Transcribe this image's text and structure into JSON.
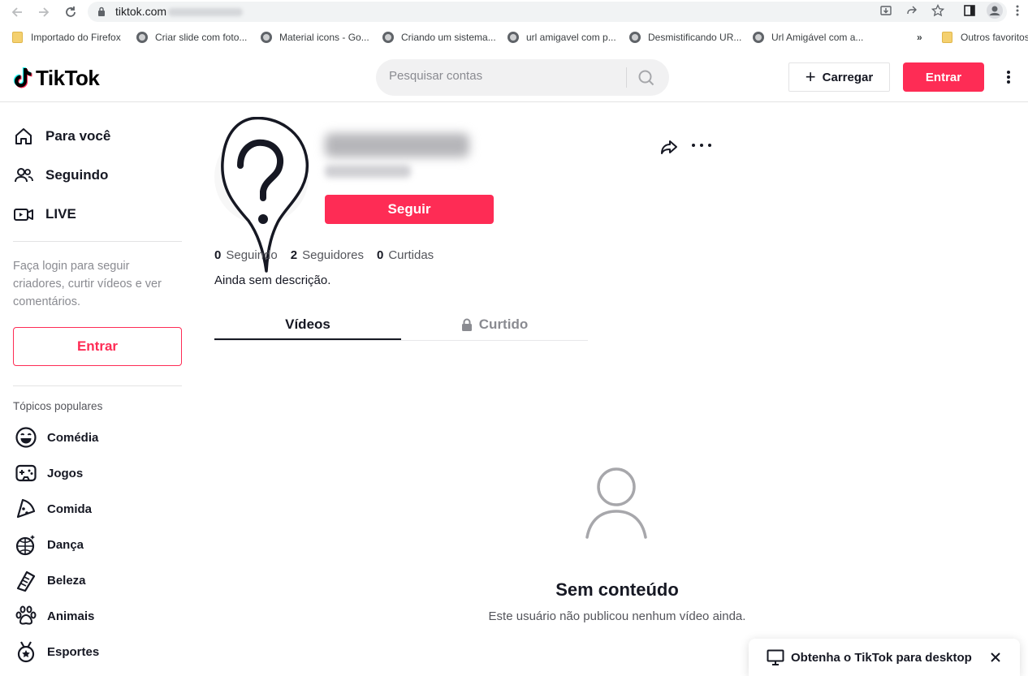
{
  "browser": {
    "url": "tiktok.com",
    "bookmarks": [
      {
        "label": "Importado do Firefox",
        "type": "folder"
      },
      {
        "label": "Criar slide com foto...",
        "type": "globe"
      },
      {
        "label": "Material icons - Go...",
        "type": "globe"
      },
      {
        "label": "Criando um sistema...",
        "type": "globe"
      },
      {
        "label": "url amigavel com p...",
        "type": "globe"
      },
      {
        "label": "Desmistificando UR...",
        "type": "globe"
      },
      {
        "label": "Url Amigável com a...",
        "type": "globe"
      }
    ],
    "overflow_label": "»",
    "other_bookmarks": "Outros favoritos"
  },
  "header": {
    "logo_text": "TikTok",
    "search_placeholder": "Pesquisar contas",
    "upload_label": "Carregar",
    "login_label": "Entrar"
  },
  "sidebar": {
    "nav": [
      {
        "label": "Para você",
        "icon": "home-icon"
      },
      {
        "label": "Seguindo",
        "icon": "users-icon"
      },
      {
        "label": "LIVE",
        "icon": "live-icon"
      }
    ],
    "login_hint": "Faça login para seguir criadores, curtir vídeos e ver comentários.",
    "login_button": "Entrar",
    "topics_title": "Tópicos populares",
    "topics": [
      {
        "label": "Comédia",
        "icon": "comedy-icon"
      },
      {
        "label": "Jogos",
        "icon": "gamepad-icon"
      },
      {
        "label": "Comida",
        "icon": "pizza-icon"
      },
      {
        "label": "Dança",
        "icon": "disco-ball-icon"
      },
      {
        "label": "Beleza",
        "icon": "comb-icon"
      },
      {
        "label": "Animais",
        "icon": "paw-icon"
      },
      {
        "label": "Esportes",
        "icon": "medal-icon"
      }
    ]
  },
  "profile": {
    "follow_label": "Seguir",
    "stats": [
      {
        "value": "0",
        "label": "Seguindo"
      },
      {
        "value": "2",
        "label": "Seguidores"
      },
      {
        "value": "0",
        "label": "Curtidas"
      }
    ],
    "bio": "Ainda sem descrição.",
    "tabs": {
      "videos": "Vídeos",
      "liked": "Curtido"
    },
    "empty_title": "Sem conteúdo",
    "empty_subtitle": "Este usuário não publicou nenhum vídeo ainda."
  },
  "banner": {
    "label": "Obtenha o TikTok para desktop"
  },
  "colors": {
    "brand": "#fe2c55",
    "text": "#161823",
    "muted": "#8a8b91"
  }
}
